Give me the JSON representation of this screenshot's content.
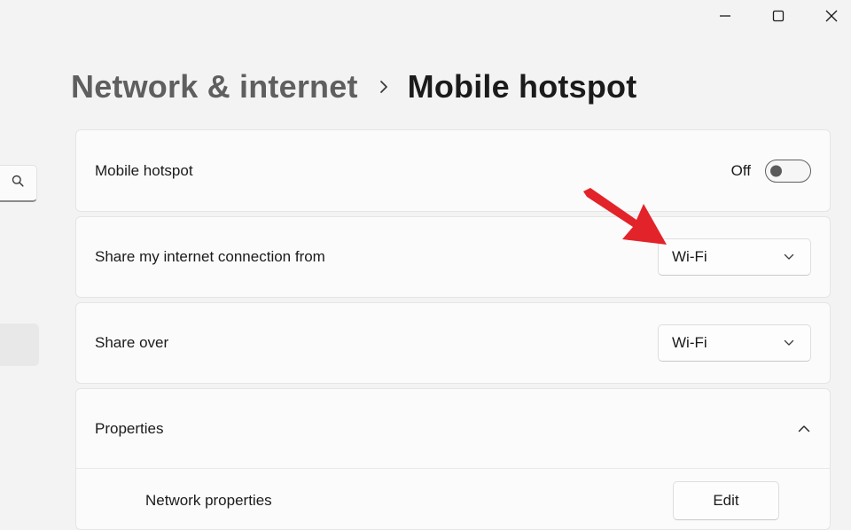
{
  "window": {
    "minimize_icon": "minimize-icon",
    "maximize_icon": "maximize-icon",
    "close_icon": "close-icon"
  },
  "breadcrumb": {
    "parent": "Network & internet",
    "separator_icon": "chevron-right-icon",
    "current": "Mobile hotspot"
  },
  "nav": {
    "search_icon": "search-icon"
  },
  "settings": {
    "hotspot": {
      "label": "Mobile hotspot",
      "state_label": "Off",
      "enabled": false
    },
    "share_from": {
      "label": "Share my internet connection from",
      "value": "Wi-Fi"
    },
    "share_over": {
      "label": "Share over",
      "value": "Wi-Fi"
    },
    "properties": {
      "label": "Properties",
      "expanded": true,
      "network_properties_label": "Network properties",
      "edit_label": "Edit"
    }
  },
  "colors": {
    "background": "#f3f3f3",
    "card": "#fbfbfb",
    "annotation_arrow": "#e3232a"
  }
}
